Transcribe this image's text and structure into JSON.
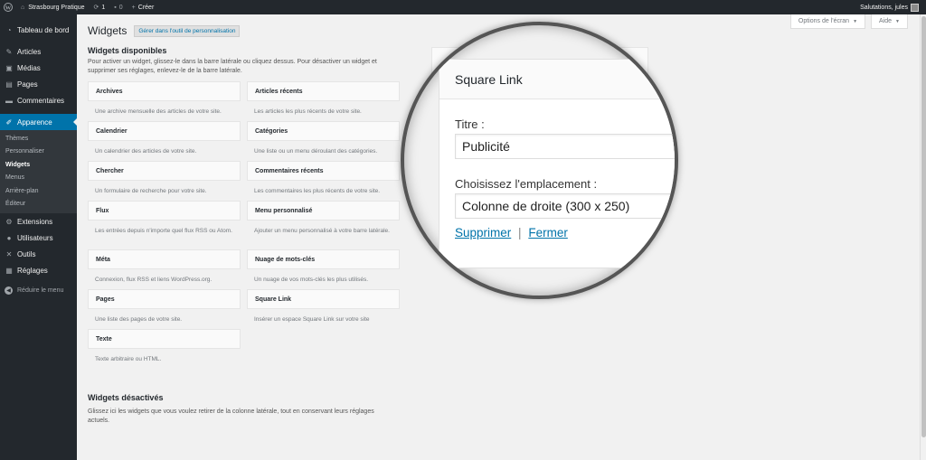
{
  "adminbar": {
    "site_name": "Strasbourg Pratique",
    "updates_count": "1",
    "comments_count": "0",
    "new_label": "Créer",
    "greeting": "Salutations, jules"
  },
  "sidebar": {
    "items_top": [
      {
        "label": "Tableau de bord",
        "icon": "dashboard-icon"
      },
      {
        "label": "Articles",
        "icon": "pin-icon"
      },
      {
        "label": "Médias",
        "icon": "media-icon"
      },
      {
        "label": "Pages",
        "icon": "pages-icon"
      },
      {
        "label": "Commentaires",
        "icon": "comments-icon"
      }
    ],
    "active": {
      "label": "Apparence",
      "icon": "brush-icon"
    },
    "submenu": [
      "Thèmes",
      "Personnaliser",
      "Widgets",
      "Menus",
      "Arrière-plan",
      "Éditeur"
    ],
    "items_bottom": [
      {
        "label": "Extensions",
        "icon": "plugins-icon"
      },
      {
        "label": "Utilisateurs",
        "icon": "users-icon"
      },
      {
        "label": "Outils",
        "icon": "tools-icon"
      },
      {
        "label": "Réglages",
        "icon": "settings-icon"
      }
    ],
    "collapse_label": "Réduire le menu"
  },
  "screen_options": {
    "options_label": "Options de l'écran",
    "help_label": "Aide"
  },
  "page": {
    "title": "Widgets",
    "customize_label": "Gérer dans l'outil de personnalisation",
    "available_title": "Widgets disponibles",
    "available_desc": "Pour activer un widget, glissez-le dans la barre latérale ou cliquez dessus. Pour désactiver un widget et supprimer ses réglages, enlevez-le de la barre latérale.",
    "inactive_title": "Widgets désactivés",
    "inactive_desc": "Glissez ici les widgets que vous voulez retirer de la colonne latérale, tout en conservant leurs réglages actuels."
  },
  "widgets": [
    {
      "name": "Archives",
      "desc": "Une archive mensuelle des articles de votre site."
    },
    {
      "name": "Articles récents",
      "desc": "Les articles les plus récents de votre site."
    },
    {
      "name": "Calendrier",
      "desc": "Un calendrier des articles de votre site."
    },
    {
      "name": "Catégories",
      "desc": "Une liste ou un menu déroulant des catégories."
    },
    {
      "name": "Chercher",
      "desc": "Un formulaire de recherche pour votre site."
    },
    {
      "name": "Commentaires récents",
      "desc": "Les commentaires les plus récents de votre site."
    },
    {
      "name": "Flux",
      "desc": "Les entrées depuis n'importe quel flux RSS ou Atom."
    },
    {
      "name": "Menu personnalisé",
      "desc": "Ajouter un menu personnalisé à votre barre latérale."
    },
    {
      "name": "Méta",
      "desc": "Connexion, flux RSS et liens WordPress.org."
    },
    {
      "name": "Nuage de mots-clés",
      "desc": "Un nuage de vos mots-clés les plus utilisés."
    },
    {
      "name": "Pages",
      "desc": "Une liste des pages de votre site."
    },
    {
      "name": "Square Link",
      "desc": "Insérer un espace Square Link sur votre site"
    },
    {
      "name": "Texte",
      "desc": "Texte arbitraire ou HTML."
    }
  ],
  "zoom_panel": {
    "title": "Square Link",
    "title_field_label": "Titre :",
    "title_field_value": "Publicité",
    "location_label": "Choisissez l'emplacement :",
    "location_value": "Colonne de droite (300 x 250)",
    "delete_label": "Supprimer",
    "separator": "|",
    "close_label": "Fermer"
  }
}
